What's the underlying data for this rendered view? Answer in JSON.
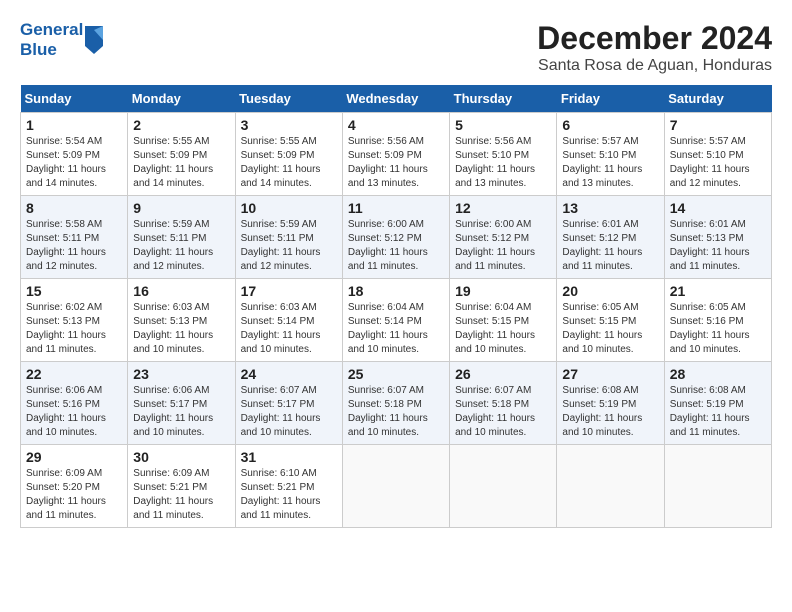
{
  "header": {
    "logo_general": "General",
    "logo_blue": "Blue",
    "month_title": "December 2024",
    "location": "Santa Rosa de Aguan, Honduras"
  },
  "calendar": {
    "weekdays": [
      "Sunday",
      "Monday",
      "Tuesday",
      "Wednesday",
      "Thursday",
      "Friday",
      "Saturday"
    ],
    "weeks": [
      [
        {
          "day": "1",
          "sunrise": "5:54 AM",
          "sunset": "5:09 PM",
          "daylight": "11 hours and 14 minutes."
        },
        {
          "day": "2",
          "sunrise": "5:55 AM",
          "sunset": "5:09 PM",
          "daylight": "11 hours and 14 minutes."
        },
        {
          "day": "3",
          "sunrise": "5:55 AM",
          "sunset": "5:09 PM",
          "daylight": "11 hours and 14 minutes."
        },
        {
          "day": "4",
          "sunrise": "5:56 AM",
          "sunset": "5:09 PM",
          "daylight": "11 hours and 13 minutes."
        },
        {
          "day": "5",
          "sunrise": "5:56 AM",
          "sunset": "5:10 PM",
          "daylight": "11 hours and 13 minutes."
        },
        {
          "day": "6",
          "sunrise": "5:57 AM",
          "sunset": "5:10 PM",
          "daylight": "11 hours and 13 minutes."
        },
        {
          "day": "7",
          "sunrise": "5:57 AM",
          "sunset": "5:10 PM",
          "daylight": "11 hours and 12 minutes."
        }
      ],
      [
        {
          "day": "8",
          "sunrise": "5:58 AM",
          "sunset": "5:11 PM",
          "daylight": "11 hours and 12 minutes."
        },
        {
          "day": "9",
          "sunrise": "5:59 AM",
          "sunset": "5:11 PM",
          "daylight": "11 hours and 12 minutes."
        },
        {
          "day": "10",
          "sunrise": "5:59 AM",
          "sunset": "5:11 PM",
          "daylight": "11 hours and 12 minutes."
        },
        {
          "day": "11",
          "sunrise": "6:00 AM",
          "sunset": "5:12 PM",
          "daylight": "11 hours and 11 minutes."
        },
        {
          "day": "12",
          "sunrise": "6:00 AM",
          "sunset": "5:12 PM",
          "daylight": "11 hours and 11 minutes."
        },
        {
          "day": "13",
          "sunrise": "6:01 AM",
          "sunset": "5:12 PM",
          "daylight": "11 hours and 11 minutes."
        },
        {
          "day": "14",
          "sunrise": "6:01 AM",
          "sunset": "5:13 PM",
          "daylight": "11 hours and 11 minutes."
        }
      ],
      [
        {
          "day": "15",
          "sunrise": "6:02 AM",
          "sunset": "5:13 PM",
          "daylight": "11 hours and 11 minutes."
        },
        {
          "day": "16",
          "sunrise": "6:03 AM",
          "sunset": "5:13 PM",
          "daylight": "11 hours and 10 minutes."
        },
        {
          "day": "17",
          "sunrise": "6:03 AM",
          "sunset": "5:14 PM",
          "daylight": "11 hours and 10 minutes."
        },
        {
          "day": "18",
          "sunrise": "6:04 AM",
          "sunset": "5:14 PM",
          "daylight": "11 hours and 10 minutes."
        },
        {
          "day": "19",
          "sunrise": "6:04 AM",
          "sunset": "5:15 PM",
          "daylight": "11 hours and 10 minutes."
        },
        {
          "day": "20",
          "sunrise": "6:05 AM",
          "sunset": "5:15 PM",
          "daylight": "11 hours and 10 minutes."
        },
        {
          "day": "21",
          "sunrise": "6:05 AM",
          "sunset": "5:16 PM",
          "daylight": "11 hours and 10 minutes."
        }
      ],
      [
        {
          "day": "22",
          "sunrise": "6:06 AM",
          "sunset": "5:16 PM",
          "daylight": "11 hours and 10 minutes."
        },
        {
          "day": "23",
          "sunrise": "6:06 AM",
          "sunset": "5:17 PM",
          "daylight": "11 hours and 10 minutes."
        },
        {
          "day": "24",
          "sunrise": "6:07 AM",
          "sunset": "5:17 PM",
          "daylight": "11 hours and 10 minutes."
        },
        {
          "day": "25",
          "sunrise": "6:07 AM",
          "sunset": "5:18 PM",
          "daylight": "11 hours and 10 minutes."
        },
        {
          "day": "26",
          "sunrise": "6:07 AM",
          "sunset": "5:18 PM",
          "daylight": "11 hours and 10 minutes."
        },
        {
          "day": "27",
          "sunrise": "6:08 AM",
          "sunset": "5:19 PM",
          "daylight": "11 hours and 10 minutes."
        },
        {
          "day": "28",
          "sunrise": "6:08 AM",
          "sunset": "5:19 PM",
          "daylight": "11 hours and 11 minutes."
        }
      ],
      [
        {
          "day": "29",
          "sunrise": "6:09 AM",
          "sunset": "5:20 PM",
          "daylight": "11 hours and 11 minutes."
        },
        {
          "day": "30",
          "sunrise": "6:09 AM",
          "sunset": "5:21 PM",
          "daylight": "11 hours and 11 minutes."
        },
        {
          "day": "31",
          "sunrise": "6:10 AM",
          "sunset": "5:21 PM",
          "daylight": "11 hours and 11 minutes."
        },
        null,
        null,
        null,
        null
      ]
    ],
    "labels": {
      "sunrise": "Sunrise:",
      "sunset": "Sunset:",
      "daylight": "Daylight:"
    }
  }
}
